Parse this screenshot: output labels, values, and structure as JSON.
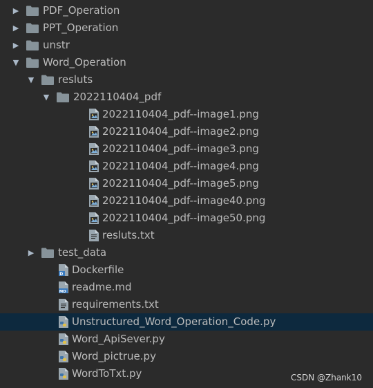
{
  "tree": {
    "items": [
      {
        "label": "PDF_Operation",
        "type": "folder",
        "depth": 0,
        "expanded": false
      },
      {
        "label": "PPT_Operation",
        "type": "folder",
        "depth": 0,
        "expanded": false
      },
      {
        "label": "unstr",
        "type": "folder",
        "depth": 0,
        "expanded": false
      },
      {
        "label": "Word_Operation",
        "type": "folder",
        "depth": 0,
        "expanded": true
      },
      {
        "label": "resluts",
        "type": "folder",
        "depth": 1,
        "expanded": true
      },
      {
        "label": "2022110404_pdf",
        "type": "folder",
        "depth": 2,
        "expanded": true
      },
      {
        "label": "2022110404_pdf--image1.png",
        "type": "png",
        "depth": 3
      },
      {
        "label": "2022110404_pdf--image2.png",
        "type": "png",
        "depth": 3
      },
      {
        "label": "2022110404_pdf--image3.png",
        "type": "png",
        "depth": 3
      },
      {
        "label": "2022110404_pdf--image4.png",
        "type": "png",
        "depth": 3
      },
      {
        "label": "2022110404_pdf--image5.png",
        "type": "png",
        "depth": 3
      },
      {
        "label": "2022110404_pdf--image40.png",
        "type": "png",
        "depth": 3
      },
      {
        "label": "2022110404_pdf--image50.png",
        "type": "png",
        "depth": 3
      },
      {
        "label": "resluts.txt",
        "type": "txt",
        "depth": 3
      },
      {
        "label": "test_data",
        "type": "folder",
        "depth": 1,
        "expanded": false
      },
      {
        "label": "Dockerfile",
        "type": "docker",
        "depth": 1
      },
      {
        "label": "readme.md",
        "type": "md",
        "depth": 1
      },
      {
        "label": "requirements.txt",
        "type": "txt",
        "depth": 1
      },
      {
        "label": "Unstructured_Word_Operation_Code.py",
        "type": "py",
        "depth": 1,
        "selected": true
      },
      {
        "label": "Word_ApiSever.py",
        "type": "py",
        "depth": 1
      },
      {
        "label": "Word_pictrue.py",
        "type": "py",
        "depth": 1
      },
      {
        "label": "WordToTxt.py",
        "type": "py",
        "depth": 1
      }
    ]
  },
  "watermark": "CSDN @Zhank10",
  "colors": {
    "background": "#2b2b2b",
    "text": "#bbbbbb",
    "selected": "#0d293e",
    "folder": "#87939a",
    "file": "#9aa7b0"
  }
}
